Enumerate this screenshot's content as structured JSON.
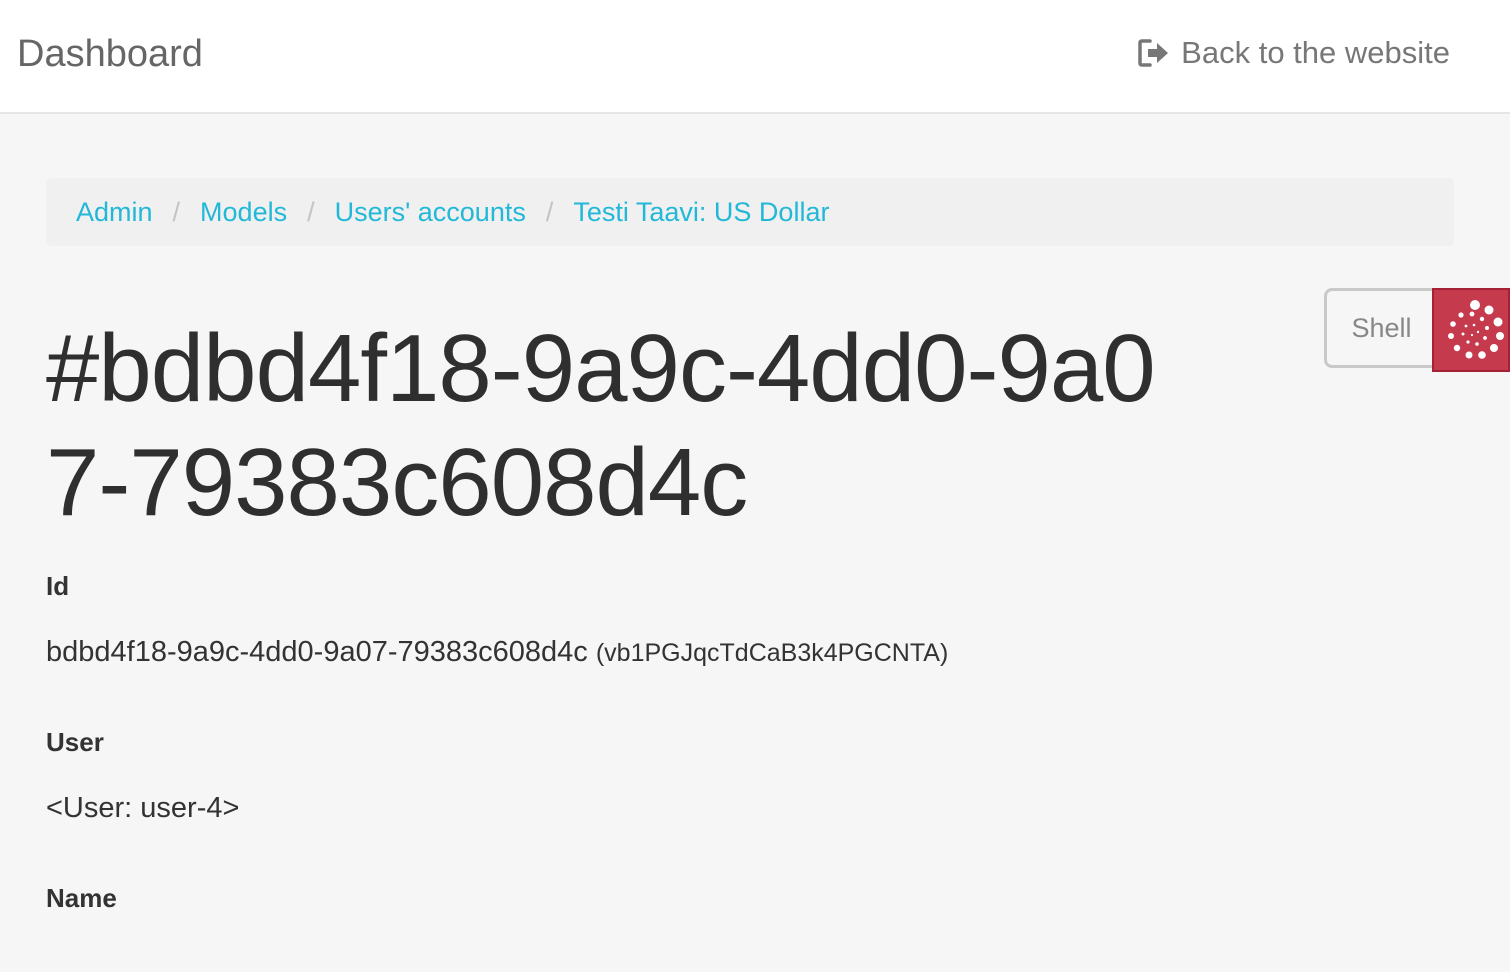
{
  "header": {
    "title": "Dashboard",
    "back_link": "Back to the website"
  },
  "breadcrumb": {
    "items": [
      "Admin",
      "Models",
      "Users' accounts",
      "Testi Taavi: US Dollar"
    ],
    "separator": "/"
  },
  "page": {
    "title": "#bdbd4f18-9a9c-4dd0-9a07-79383c608d4c"
  },
  "actions": {
    "shell_label": "Shell"
  },
  "fields": [
    {
      "label": "Id",
      "value": "bdbd4f18-9a9c-4dd0-9a07-79383c608d4c",
      "secondary": "(vb1PGJqcTdCaB3k4PGCNTA)"
    },
    {
      "label": "User",
      "value": "<User: user-4>"
    },
    {
      "label": "Name",
      "value": ""
    }
  ],
  "colors": {
    "link": "#22b8d8",
    "accent": "#c63a4e",
    "background": "#f6f6f6"
  },
  "icons": {
    "back_link": "sign-out-icon",
    "debug_toolbar": "spiral-icon"
  }
}
